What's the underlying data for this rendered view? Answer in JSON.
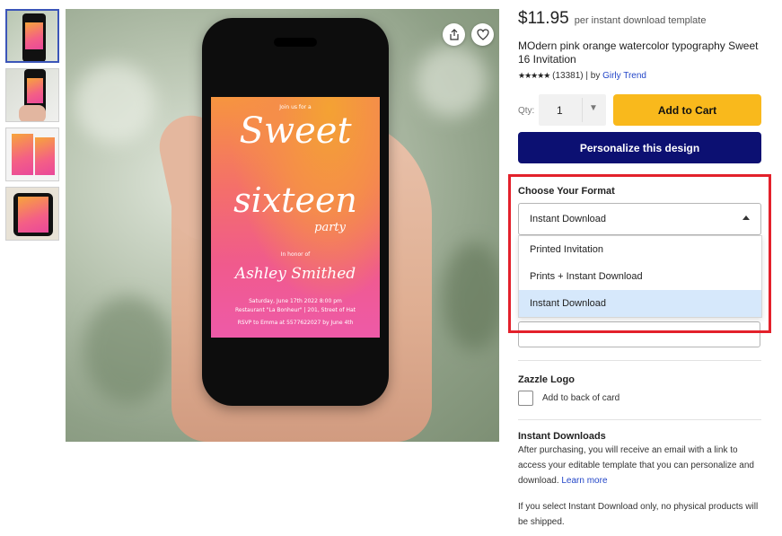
{
  "gallery": {
    "thumbnails": [
      "thumb-1",
      "thumb-2",
      "thumb-3",
      "thumb-4"
    ],
    "invitation": {
      "intro": "Join us for a",
      "line1": "Sweet",
      "line2": "sixteen",
      "line3": "party",
      "honor": "In honor of",
      "name": "Ashley Smithed",
      "details1": "Saturday, June 17th 2022 8:00 pm",
      "details2": "Restaurant \"La Bonheur\" | 201, Street of Hat",
      "rsvp": "RSVP to Emma at 5577622027 by June 4th"
    },
    "icons": {
      "share": "share-icon",
      "favorite": "heart-icon"
    }
  },
  "product": {
    "price": "$11.95",
    "price_note": "per instant download template",
    "title": "MOdern pink orange watercolor typography Sweet 16 Invitation",
    "stars": "★★★★★",
    "review_count": "(13381)",
    "by_label": "| by",
    "seller": "Girly Trend"
  },
  "purchase": {
    "qty_label": "Qty:",
    "qty_value": "1",
    "add_to_cart": "Add to Cart",
    "personalize": "Personalize this design"
  },
  "format": {
    "label": "Choose Your Format",
    "selected": "Instant Download",
    "options": [
      "Printed Invitation",
      "Prints + Instant Download",
      "Instant Download"
    ],
    "selected_index": 2
  },
  "logo": {
    "label": "Zazzle Logo",
    "checkbox_label": "Add to back of card",
    "checked": false
  },
  "instant": {
    "title": "Instant Downloads",
    "body": "After purchasing, you will receive an email with a link to access your editable template that you can personalize and download.",
    "learn_more": "Learn more",
    "note": "If you select Instant Download only, no physical products will be shipped."
  },
  "colors": {
    "add_to_cart": "#f9b91c",
    "personalize": "#0c1072",
    "highlight": "#e3212b",
    "link": "#2346c8",
    "option_selected_bg": "#d6e8fb"
  }
}
